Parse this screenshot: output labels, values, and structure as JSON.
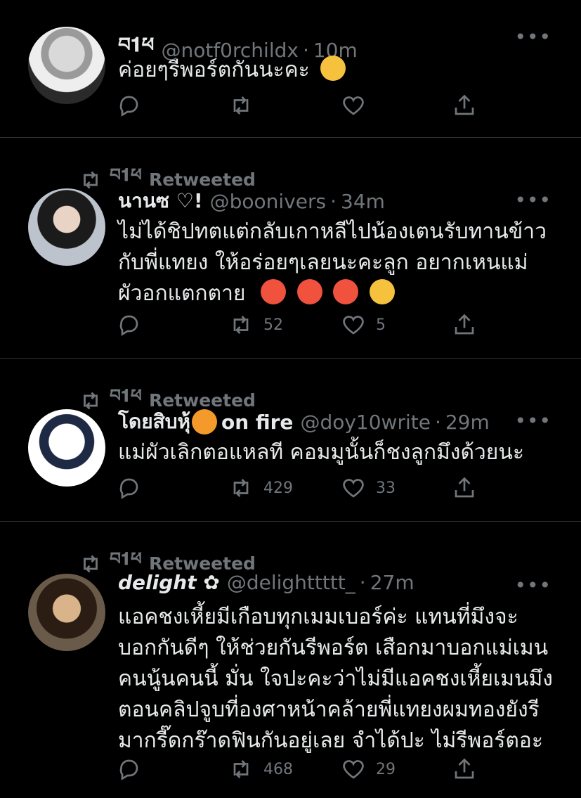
{
  "retweet_label": "Retweeted",
  "tweets": [
    {
      "name": "བ𝟏ཕ",
      "handle": "@notf0rchildx",
      "time": "10m",
      "text": "ค่อยๆรีพอร์ตกันนะคะ",
      "emoji": [
        "kissing-face-emoji"
      ],
      "retweeted": false,
      "retweets": "",
      "likes": ""
    },
    {
      "retweeted_by": "བ𝟏ཕ",
      "name": "นานซ ♡!",
      "handle": "@boonivers",
      "time": "34m",
      "text_lines": [
        "ไม่ได้ชิปทตแต่กลับเกาหลีไปน้องเตนรับทานข้าว",
        "กับพี่แทยง ให้อร่อยๆเลยนะคะลูก อยากเหนแม่",
        "ผัวอกแตกตาย"
      ],
      "emoji": [
        "hot-face-emoji",
        "hot-face-emoji",
        "hot-face-emoji",
        "angry-face-emoji"
      ],
      "retweeted": true,
      "retweets": "52",
      "likes": "5"
    },
    {
      "retweeted_by": "བ𝟏ཕ",
      "name": "โดยสิบหุ้",
      "name_suffix": "on fire",
      "handle": "@doy10write",
      "time": "29m",
      "text": "แม่ผัวเลิกตอแหลที คอมมูนั้นก็ชงลูกมึงด้วยนะ",
      "retweeted": true,
      "retweets": "429",
      "likes": "33"
    },
    {
      "retweeted_by": "བ𝟏ཕ",
      "name": "delight ✿",
      "handle": "@delighttttt_",
      "time": "27m",
      "text_lines": [
        "แอคชงเหี้ยมีเกือบทุกเมมเบอร์ค่ะ แทนที่มึงจะ",
        "บอกกันดีๆ ให้ช่วยกันรีพอร์ต เสือกมาบอกแม่เมน",
        "คนนู้นคนนี้ มั่น ใจปะคะว่าไม่มีแอคชงเหี้ยเมนมึง",
        "ตอนคลิปจูบที่องศาหน้าคล้ายพี่แทยงผมทองยังรี",
        "มากรี๊ดกร๊าดฟินกันอยู่เลย จำได้ปะ ไม่รีพอร์ตอะ"
      ],
      "retweeted": true,
      "retweets": "468",
      "likes": "29"
    }
  ],
  "colors": {
    "background": "#000000",
    "text": "#e7e9ea",
    "muted": "#71767b",
    "divider": "#2f3336"
  }
}
